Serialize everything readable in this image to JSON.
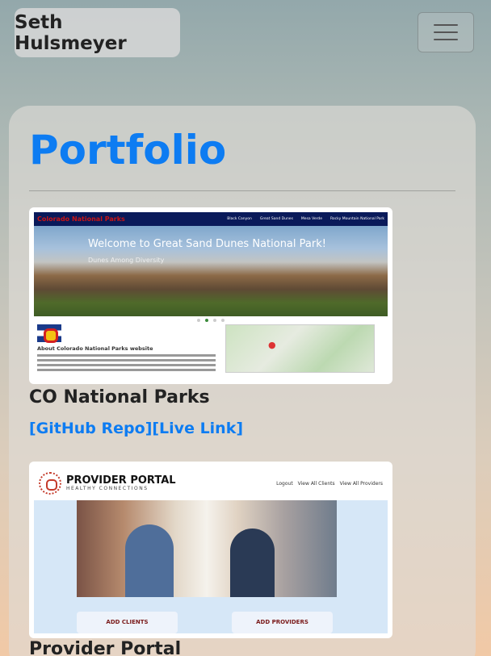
{
  "navbar": {
    "brand": "Seth Hulsmeyer",
    "toggler_icon": "hamburger-menu-icon"
  },
  "page": {
    "title": "Portfolio"
  },
  "projects": [
    {
      "title": "CO National Parks",
      "repo_label": "[GitHub Repo]",
      "live_label": "[Live Link]",
      "screenshot": {
        "site_title": "Colorado National Parks",
        "nav": [
          "Black Canyon",
          "Great Sand Dunes",
          "Mesa Verde",
          "Rocky Mountain National Park"
        ],
        "hero_heading": "Welcome to Great Sand Dunes National Park!",
        "hero_subheading": "Dunes Among Diversity",
        "about_heading": "About Colorado National Parks website"
      }
    },
    {
      "title": "Provider Portal",
      "screenshot": {
        "logo_name": "PROVIDER PORTAL",
        "logo_sub": "HEALTHY CONNECTIONS",
        "nav": [
          "Logout",
          "View All Clients",
          "View All Providers"
        ],
        "btn_add_clients": "ADD CLIENTS",
        "btn_add_providers": "ADD PROVIDERS"
      }
    }
  ],
  "colors": {
    "accent": "#0d7cf2",
    "text": "#222222"
  }
}
